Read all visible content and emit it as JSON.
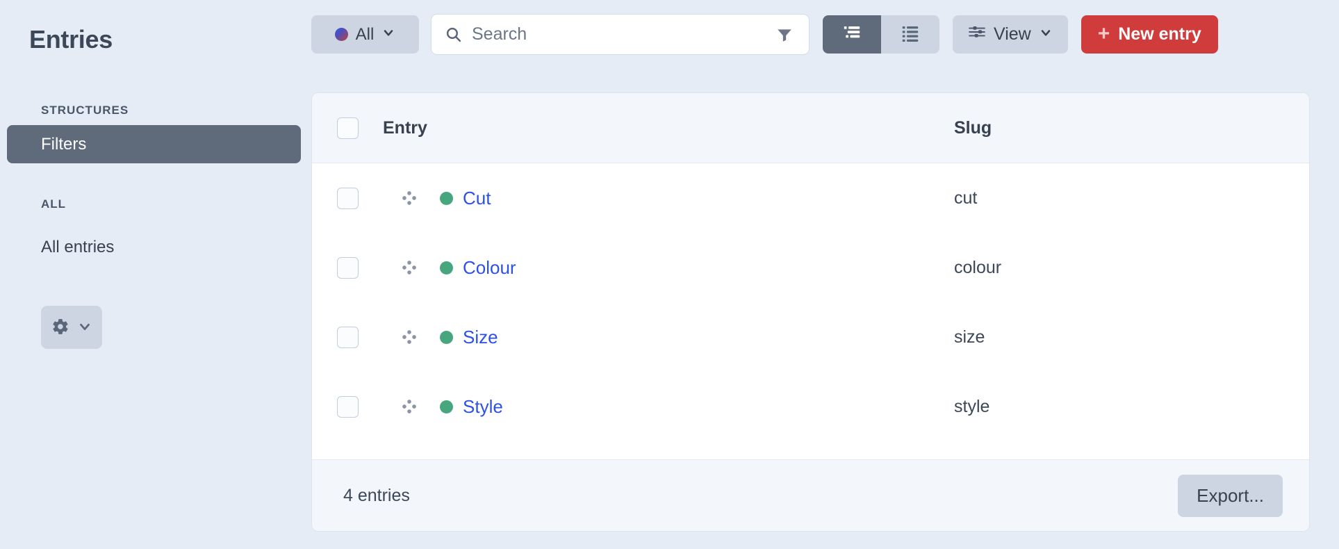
{
  "page": {
    "title": "Entries",
    "background_color": "#e6ecf5"
  },
  "sidebar": {
    "sections": [
      {
        "heading": "STRUCTURES",
        "items": [
          {
            "label": "Filters",
            "active": true
          }
        ]
      },
      {
        "heading": "ALL",
        "items": [
          {
            "label": "All entries",
            "active": false
          }
        ]
      }
    ],
    "settings_button": {
      "icon": "gear-icon",
      "chevron": "chevron-down-icon"
    }
  },
  "toolbar": {
    "source_dropdown": {
      "label": "All",
      "status_dot": "gradient-dot",
      "chevron": "chevron-down-icon"
    },
    "search": {
      "placeholder": "Search",
      "value": "",
      "icon": "search-icon",
      "filter_icon": "filter-funnel-icon"
    },
    "view_modes": [
      {
        "name": "structure-view",
        "icon": "structure-list-icon",
        "active": true
      },
      {
        "name": "list-view",
        "icon": "list-icon",
        "active": false
      }
    ],
    "view_button": {
      "label": "View",
      "icon": "sliders-icon",
      "chevron": "chevron-down-icon"
    },
    "new_entry_button": {
      "label": "New entry",
      "icon": "plus-icon",
      "color": "#d03b3b"
    }
  },
  "table": {
    "columns": [
      {
        "key": "entry",
        "label": "Entry"
      },
      {
        "key": "slug",
        "label": "Slug"
      }
    ],
    "rows": [
      {
        "title": "Cut",
        "slug": "cut",
        "status": "enabled",
        "status_color": "#47a67e"
      },
      {
        "title": "Colour",
        "slug": "colour",
        "status": "enabled",
        "status_color": "#47a67e"
      },
      {
        "title": "Size",
        "slug": "size",
        "status": "enabled",
        "status_color": "#47a67e"
      },
      {
        "title": "Style",
        "slug": "style",
        "status": "enabled",
        "status_color": "#47a67e"
      }
    ],
    "footer": {
      "count_label": "4 entries",
      "export_label": "Export..."
    }
  },
  "colors": {
    "link": "#2d51e8",
    "accent_danger": "#d03b3b",
    "status_enabled": "#47a67e",
    "active_nav": "#5f6b7a",
    "control_bg": "#ccd5e1"
  }
}
